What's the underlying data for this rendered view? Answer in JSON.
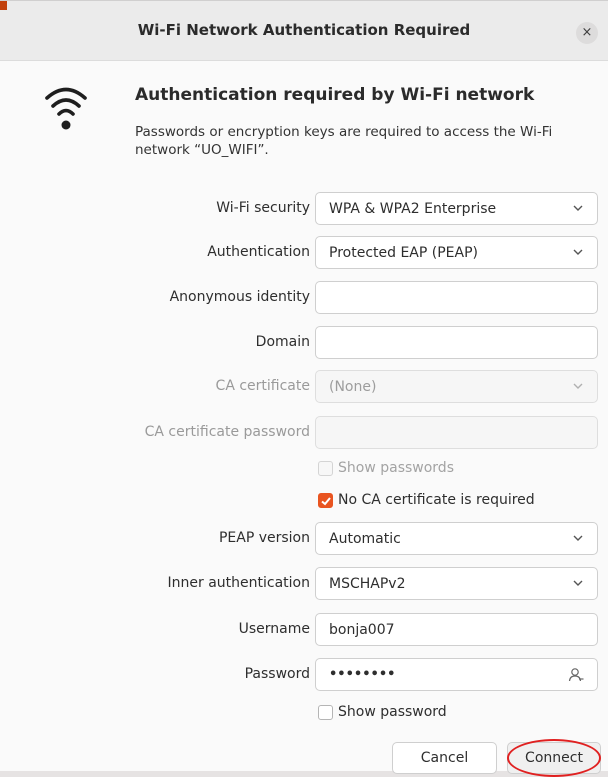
{
  "window": {
    "title": "Wi-Fi Network Authentication Required",
    "close_glyph": "×"
  },
  "icons": {
    "wifi": "wifi-signal-icon",
    "close": "close-icon",
    "dropdown": "chevron-down-icon",
    "password_toggle": "person-key-icon",
    "check": "checkmark-icon"
  },
  "header": {
    "heading": "Authentication required by Wi-Fi network",
    "description": "Passwords or encryption keys are required to access the Wi-Fi network “UO_WIFI”."
  },
  "form": {
    "wifi_security": {
      "label": "Wi-Fi security",
      "value": "WPA & WPA2 Enterprise"
    },
    "authentication": {
      "label": "Authentication",
      "value": "Protected EAP (PEAP)"
    },
    "anonymous_identity": {
      "label": "Anonymous identity",
      "value": ""
    },
    "domain": {
      "label": "Domain",
      "value": ""
    },
    "ca_certificate": {
      "label": "CA certificate",
      "value": "(None)"
    },
    "ca_certificate_password": {
      "label": "CA certificate password",
      "value": ""
    },
    "show_passwords": {
      "label": "Show passwords",
      "checked": false
    },
    "no_ca_required": {
      "label": "No CA certificate is required",
      "checked": true
    },
    "peap_version": {
      "label": "PEAP version",
      "value": "Automatic"
    },
    "inner_authentication": {
      "label": "Inner authentication",
      "value": "MSCHAPv2"
    },
    "username": {
      "label": "Username",
      "value": "bonja007"
    },
    "password": {
      "label": "Password",
      "value": "••••••••"
    },
    "show_password": {
      "label": "Show password",
      "checked": false
    }
  },
  "buttons": {
    "cancel": "Cancel",
    "connect": "Connect"
  },
  "colors": {
    "accent": "#e95420",
    "annotation": "#e02020"
  }
}
